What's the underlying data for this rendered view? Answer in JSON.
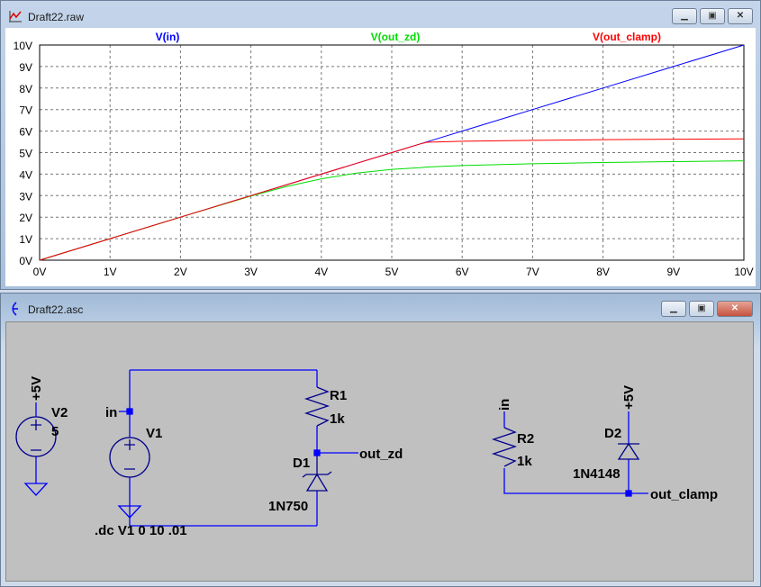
{
  "plot_window": {
    "title": "Draft22.raw",
    "buttons": [
      "minimize",
      "maximize",
      "close"
    ]
  },
  "schematic_window": {
    "title": "Draft22.asc",
    "buttons": [
      "minimize",
      "maximize",
      "close"
    ]
  },
  "chart_data": {
    "type": "line",
    "xlabel": "",
    "ylabel": "",
    "xlim": [
      0,
      10
    ],
    "ylim": [
      0,
      10
    ],
    "x_ticks": [
      "0V",
      "1V",
      "2V",
      "3V",
      "4V",
      "5V",
      "6V",
      "7V",
      "8V",
      "9V",
      "10V"
    ],
    "y_ticks": [
      "0V",
      "1V",
      "2V",
      "3V",
      "4V",
      "5V",
      "6V",
      "7V",
      "8V",
      "9V",
      "10V"
    ],
    "grid": true,
    "x": [
      0,
      1,
      2,
      3,
      3.5,
      4,
      4.5,
      5,
      5.4,
      5.5,
      6,
      7,
      8,
      9,
      10
    ],
    "series": [
      {
        "name": "V(in)",
        "color": "#0000ff",
        "values": [
          0,
          1,
          2,
          3,
          3.5,
          4,
          4.5,
          5,
          5.4,
          5.5,
          6,
          7,
          8,
          9,
          10
        ]
      },
      {
        "name": "V(out_zd)",
        "color": "#00dd00",
        "values": [
          0,
          1,
          2,
          2.98,
          3.42,
          3.78,
          4.05,
          4.22,
          4.3,
          4.33,
          4.4,
          4.48,
          4.54,
          4.58,
          4.62
        ]
      },
      {
        "name": "V(out_clamp)",
        "color": "#ff0000",
        "values": [
          0,
          1,
          2,
          3,
          3.5,
          4,
          4.5,
          5,
          5.4,
          5.48,
          5.53,
          5.57,
          5.6,
          5.62,
          5.64
        ]
      }
    ]
  },
  "schematic": {
    "v2": {
      "name": "V2",
      "value": "5",
      "net": "+5V"
    },
    "v1": {
      "name": "V1",
      "net": "in"
    },
    "r1": {
      "name": "R1",
      "value": "1k"
    },
    "d1": {
      "name": "D1",
      "model": "1N750"
    },
    "out_zd": "out_zd",
    "directive": ".dc V1 0 10 .01",
    "r2": {
      "name": "R2",
      "value": "1k",
      "net": "in"
    },
    "d2": {
      "name": "D2",
      "model": "1N4148",
      "net": "+5V"
    },
    "out_clamp": "out_clamp",
    "wire_color": "#0000ff"
  }
}
